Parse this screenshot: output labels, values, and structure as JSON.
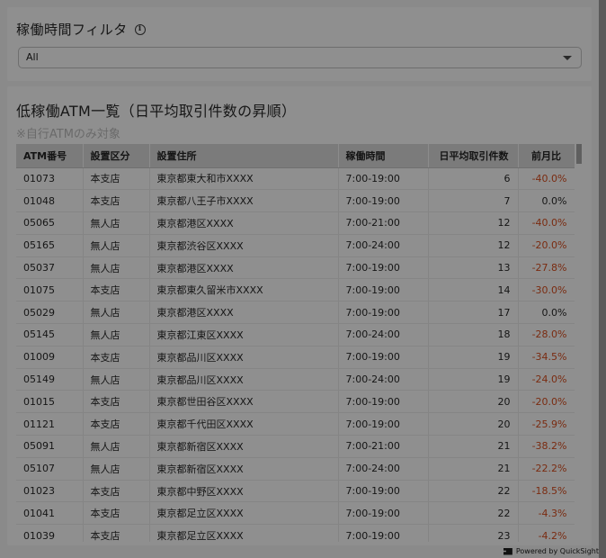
{
  "filter": {
    "title": "稼働時間フィルタ",
    "info_icon": "i",
    "selected": "All"
  },
  "table_section": {
    "title": "低稼働ATM一覧（日平均取引件数の昇順）",
    "subtitle": "※自行ATMのみ対象"
  },
  "table": {
    "columns": [
      "ATM番号",
      "設置区分",
      "設置住所",
      "稼働時間",
      "日平均取引件数",
      "前月比"
    ],
    "rows": [
      [
        "01073",
        "本支店",
        "東京都東大和市XXXX",
        "7:00-19:00",
        "6",
        "-40.0%"
      ],
      [
        "01048",
        "本支店",
        "東京都八王子市XXXX",
        "7:00-19:00",
        "7",
        "0.0%"
      ],
      [
        "05065",
        "無人店",
        "東京都港区XXXX",
        "7:00-21:00",
        "12",
        "-40.0%"
      ],
      [
        "05165",
        "無人店",
        "東京都渋谷区XXXX",
        "7:00-24:00",
        "12",
        "-20.0%"
      ],
      [
        "05037",
        "無人店",
        "東京都港区XXXX",
        "7:00-19:00",
        "13",
        "-27.8%"
      ],
      [
        "01075",
        "本支店",
        "東京都東久留米市XXXX",
        "7:00-19:00",
        "14",
        "-30.0%"
      ],
      [
        "05029",
        "無人店",
        "東京都港区XXXX",
        "7:00-19:00",
        "17",
        "0.0%"
      ],
      [
        "05145",
        "無人店",
        "東京都江東区XXXX",
        "7:00-24:00",
        "18",
        "-28.0%"
      ],
      [
        "01009",
        "本支店",
        "東京都品川区XXXX",
        "7:00-19:00",
        "19",
        "-34.5%"
      ],
      [
        "05149",
        "無人店",
        "東京都品川区XXXX",
        "7:00-24:00",
        "19",
        "-24.0%"
      ],
      [
        "01015",
        "本支店",
        "東京都世田谷区XXXX",
        "7:00-19:00",
        "20",
        "-20.0%"
      ],
      [
        "01121",
        "本支店",
        "東京都千代田区XXXX",
        "7:00-19:00",
        "20",
        "-25.9%"
      ],
      [
        "05091",
        "無人店",
        "東京都新宿区XXXX",
        "7:00-21:00",
        "21",
        "-38.2%"
      ],
      [
        "05107",
        "無人店",
        "東京都新宿区XXXX",
        "7:00-24:00",
        "21",
        "-22.2%"
      ],
      [
        "01023",
        "本支店",
        "東京都中野区XXXX",
        "7:00-19:00",
        "22",
        "-18.5%"
      ],
      [
        "01041",
        "本支店",
        "東京都足立区XXXX",
        "7:00-19:00",
        "22",
        "-4.3%"
      ],
      [
        "01039",
        "本支店",
        "東京都足立区XXXX",
        "7:00-19:00",
        "23",
        "-4.2%"
      ]
    ]
  },
  "footer": {
    "powered_by": "Powered by QuickSight"
  },
  "colors": {
    "negative": "#7a2b10"
  }
}
